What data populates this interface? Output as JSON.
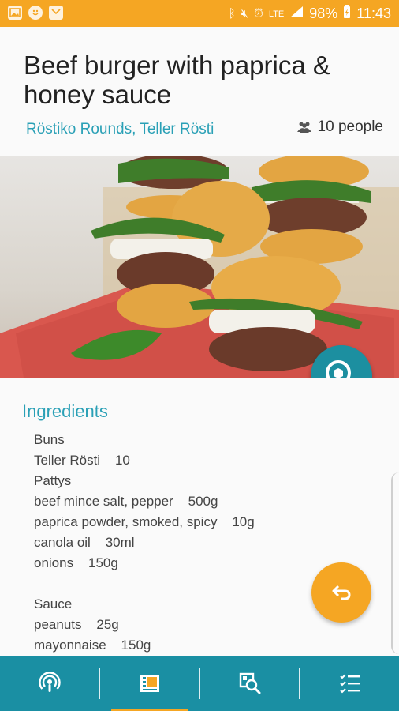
{
  "status_bar": {
    "battery": "98%",
    "time": "11:43",
    "network": "LTE",
    "icons": [
      "gallery-icon",
      "emoji-icon",
      "mail-icon",
      "bluetooth-icon",
      "mute-icon",
      "alarm-icon",
      "signal-icon",
      "battery-icon"
    ]
  },
  "recipe": {
    "title": "Beef burger with paprica & honey sauce",
    "products": "Röstiko Rounds, Teller Rösti",
    "servings": "10 people"
  },
  "ingredients": {
    "heading": "Ingredients",
    "lines": [
      "Buns",
      "Teller Rösti    10",
      "Pattys",
      "beef mince salt, pepper    500g",
      "paprica powder, smoked, spicy    10g",
      "canola oil    30ml",
      "onions    150g",
      "",
      "Sauce",
      "peanuts    25g",
      "mayonnaise    150g"
    ]
  },
  "bottom_nav": {
    "items": [
      "podcast-icon",
      "recipe-card-icon",
      "product-search-icon",
      "checklist-icon"
    ],
    "active_index": 1
  },
  "colors": {
    "accent_orange": "#f5a623",
    "teal": "#1a8fa3",
    "link_teal": "#2aa0b6"
  }
}
